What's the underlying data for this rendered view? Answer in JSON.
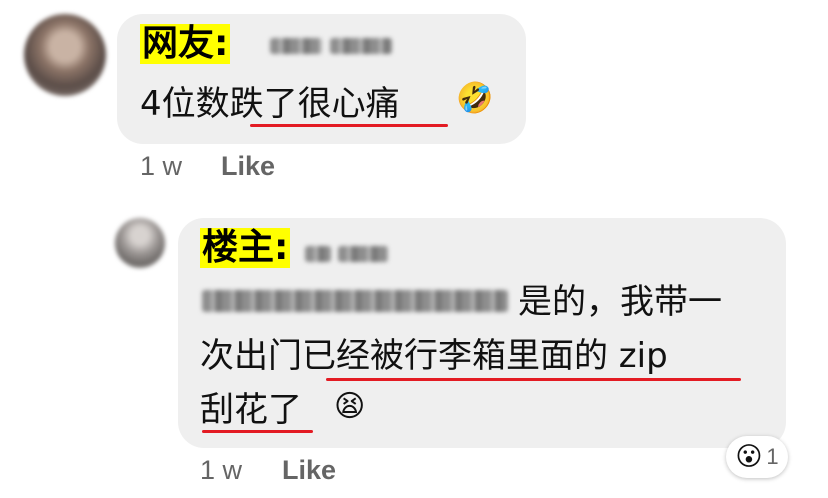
{
  "comment1": {
    "author_tag": "网友:",
    "text": "4位数跌了很心痛",
    "reaction_emoji": "🤣",
    "time": "1 w",
    "like_label": "Like"
  },
  "comment2": {
    "author_tag": "楼主:",
    "line1": "是的，我带一",
    "line2": "次出门已经被行李箱里面的 zip",
    "line3": "刮花了",
    "reaction_emoji": "😫",
    "time": "1 w",
    "like_label": "Like",
    "reaction_badge_emoji": "😮",
    "reaction_count": "1"
  },
  "colors": {
    "bubble": "#efefef",
    "highlight": "#ffff00",
    "underline": "#e31b23",
    "meta": "#656565"
  }
}
